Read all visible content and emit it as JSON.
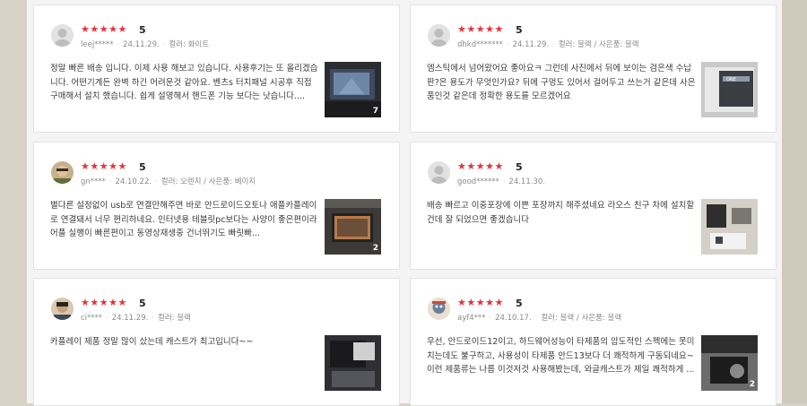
{
  "reviews": [
    {
      "user": "leej*****",
      "date": "24.11.29.",
      "score": "5",
      "option": "컬러: 화이트",
      "text": "정말 빠른 배송 입니다. 이제 사용 해보고 있습니다. 사용후기는 또 올리겠습니다. 어떤기계든 완벽 하긴 어려운것 같아요. 벤츠s 터치패널 시공후 직접 구매해서 설치 했습니다. 쉽게 설명해서 핸드폰 기능 보다는 낫습니다....",
      "photo_count": "7",
      "avatar": "default-avatar-icon"
    },
    {
      "user": "dhkd*******",
      "date": "24.11.29.",
      "score": "5",
      "option": "컬러: 블랙 / 사은품: 블랙",
      "text": "엠스틱에서 넘어왔어요 좋아요ㅋ 그런데 사진에서 뒤에 보이는 검은색 수납판?은 용도가 무엇인가요? 뒤에 구멍도 있어서 걸어두고 쓰는거 같은데 사은품인것 같은데 정확한 용도를 모르겠어요",
      "photo_count": "",
      "avatar": "default-avatar-icon"
    },
    {
      "user": "gn****",
      "date": "24.10.22.",
      "score": "5",
      "option": "컬러: 오렌지 / 사은품: 베이지",
      "text": "별다른 설정없이 usb로 연결만해주면 바로 안드로이드오토나 애플카플레이로 연결돼서 너무 편리하네요. 인터넷용 테블릿pc보다는 사양이 좋은편이라 어플 실행이 빠른편이고 동영상재생중 건너뛰기도 빠릿빠...",
      "photo_count": "2",
      "avatar": "user-photo-avatar"
    },
    {
      "user": "good******",
      "date": "24.11.30.",
      "score": "5",
      "option": "",
      "text": "배송 빠르고 이중포장에 이쁜 포장까지 해주셨네요 라오스 친구 차에 설치할건데 잘 되었으면 좋겠습니다",
      "photo_count": "",
      "avatar": "default-avatar-icon"
    },
    {
      "user": "ci****",
      "date": "24.11.29.",
      "score": "5",
      "option": "컬러: 블랙",
      "text": "카플레이 제품 정말 많이 샀는데 캐스트가 최고입니다~~",
      "photo_count": "",
      "avatar": "user-photo-avatar"
    },
    {
      "user": "ayf4***",
      "date": "24.10.17.",
      "score": "5",
      "option": "컬러: 블랙 / 사은품: 블랙",
      "text": "우선, 안드로이드12이고, 하드웨어성능이 타제품의 압도적인 스펙에는 못미치는데도 불구하고, 사용성이 타제품 안드13보다 더 쾌적하게 구동되네요~ 이런 제품류는 나름 이것저것 사용해봤는데, 와글캐스트가 제일 쾌적하게 ...",
      "photo_count": "2",
      "avatar": "user-photo-avatar"
    }
  ],
  "stars": "★★★★★",
  "colors": {
    "star": "#e8313a",
    "text": "#3c3c3c",
    "meta": "#8a8a8a"
  }
}
